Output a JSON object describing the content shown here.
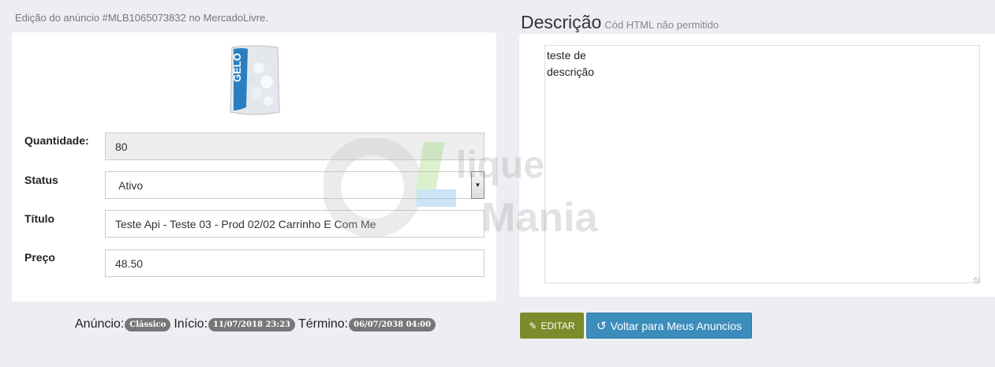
{
  "header": {
    "text": "Edição do anúncio #MLB1065073832 no MercadoLivre."
  },
  "product": {
    "image_label": "GELO"
  },
  "form": {
    "quantity": {
      "label": "Quantidade:",
      "value": "80"
    },
    "status": {
      "label": "Status",
      "value": "Ativo"
    },
    "title": {
      "label": "Título",
      "value": "Teste Api - Teste 03 - Prod 02/02 Carrinho E Com Me"
    },
    "price": {
      "label": "Preço",
      "value": "48.50"
    }
  },
  "description": {
    "title": "Descrição",
    "subtitle": "Cód HTML não permitido",
    "text": "teste de\ndescrição"
  },
  "footer": {
    "anuncio_label": "Anúncio:",
    "anuncio_value": "Clássico",
    "inicio_label": "Início:",
    "inicio_value": "11/07/2018 23:23",
    "termino_label": "Término:",
    "termino_value": "06/07/2038 04:00"
  },
  "buttons": {
    "edit_label": "EDITAR",
    "back_label": "Voltar para Meus Anuncios"
  },
  "watermark": {
    "line1": "lique",
    "line2": "Mania"
  },
  "colors": {
    "edit_button": "#7c8b2c",
    "back_button": "#3c8dbc",
    "badge": "#777777"
  }
}
